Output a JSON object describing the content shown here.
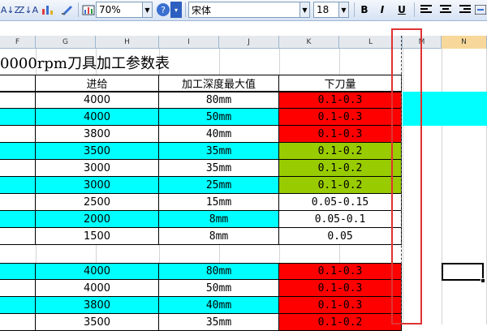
{
  "toolbar": {
    "zoom": "70%",
    "font_name": "宋体",
    "font_size": "18",
    "bold": "B",
    "italic": "I",
    "underline": "U",
    "sort_asc": "A↓Z",
    "sort_desc": "Z↓A",
    "help": "?"
  },
  "columns": [
    "F",
    "G",
    "H",
    "I",
    "J",
    "K",
    "L",
    "M",
    "N"
  ],
  "sheet": {
    "title": "0000rpm刀具加工参数表",
    "headers": {
      "feed": "进给",
      "depth": "加工深度最大值",
      "cut": "下刀量"
    },
    "group1": [
      {
        "feed": "4000",
        "depth": "80mm",
        "cut": "0.1-0.3",
        "row_color": "#ffffff",
        "cut_color": "#ff0000"
      },
      {
        "feed": "4000",
        "depth": "50mm",
        "cut": "0.1-0.3",
        "row_color": "#00ffff",
        "cut_color": "#ff0000"
      },
      {
        "feed": "3800",
        "depth": "40mm",
        "cut": "0.1-0.3",
        "row_color": "#ffffff",
        "cut_color": "#ff0000"
      },
      {
        "feed": "3500",
        "depth": "35mm",
        "cut": "0.1-0.2",
        "row_color": "#00ffff",
        "cut_color": "#99cc00"
      },
      {
        "feed": "3000",
        "depth": "35mm",
        "cut": "0.1-0.2",
        "row_color": "#ffffff",
        "cut_color": "#99cc00"
      },
      {
        "feed": "3000",
        "depth": "25mm",
        "cut": "0.1-0.2",
        "row_color": "#00ffff",
        "cut_color": "#99cc00"
      },
      {
        "feed": "2500",
        "depth": "15mm",
        "cut": "0.05-0.15",
        "row_color": "#ffffff",
        "cut_color": "#ffffff"
      },
      {
        "feed": "2000",
        "depth": "8mm",
        "cut": "0.05-0.1",
        "row_color": "#00ffff",
        "cut_color": "#ffffff"
      },
      {
        "feed": "1500",
        "depth": "8mm",
        "cut": "0.05",
        "row_color": "#ffffff",
        "cut_color": "#ffffff"
      }
    ],
    "group2": [
      {
        "feed": "4000",
        "depth": "80mm",
        "cut": "0.1-0.3",
        "row_color": "#00ffff",
        "cut_color": "#ff0000"
      },
      {
        "feed": "4000",
        "depth": "50mm",
        "cut": "0.1-0.3",
        "row_color": "#ffffff",
        "cut_color": "#ff0000"
      },
      {
        "feed": "3800",
        "depth": "40mm",
        "cut": "0.1-0.3",
        "row_color": "#00ffff",
        "cut_color": "#ff0000"
      },
      {
        "feed": "3500",
        "depth": "35mm",
        "cut": "0.1-0.2",
        "row_color": "#ffffff",
        "cut_color": "#ff0000"
      }
    ]
  },
  "colors": {
    "cyan": "#00ffff",
    "red": "#ff0000",
    "green": "#99cc00"
  }
}
